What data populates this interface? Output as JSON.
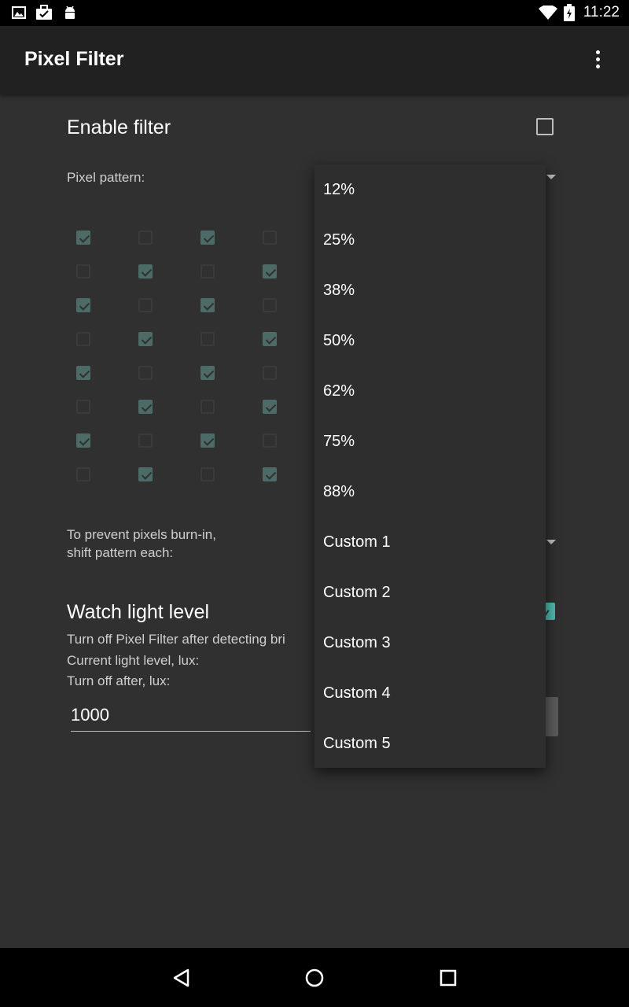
{
  "status_bar": {
    "time": "11:22"
  },
  "app_bar": {
    "title": "Pixel Filter"
  },
  "settings": {
    "enable_filter_label": "Enable filter",
    "pixel_pattern_label": "Pixel pattern:",
    "burn_in_line1": "To prevent pixels burn-in,",
    "burn_in_line2": "shift pattern each:",
    "watch_light_label": "Watch light level",
    "watch_light_desc": "Turn off Pixel Filter after detecting bri",
    "current_light_label": "Current light level, lux:",
    "turn_off_after_label": "Turn off after, lux:",
    "lux_value": "1000"
  },
  "dropdown_options": [
    "12%",
    "25%",
    "38%",
    "50%",
    "62%",
    "75%",
    "88%",
    "Custom 1",
    "Custom 2",
    "Custom 3",
    "Custom 4",
    "Custom 5"
  ],
  "pattern_grid": [
    [
      true,
      false,
      true,
      false
    ],
    [
      false,
      true,
      false,
      true
    ],
    [
      true,
      false,
      true,
      false
    ],
    [
      false,
      true,
      false,
      true
    ],
    [
      true,
      false,
      true,
      false
    ],
    [
      false,
      true,
      false,
      true
    ],
    [
      true,
      false,
      true,
      false
    ],
    [
      false,
      true,
      false,
      true
    ]
  ],
  "colors": {
    "accent": "#4db6ac",
    "background": "#303030",
    "appbar": "#212121",
    "menu": "#2e2e2e"
  }
}
